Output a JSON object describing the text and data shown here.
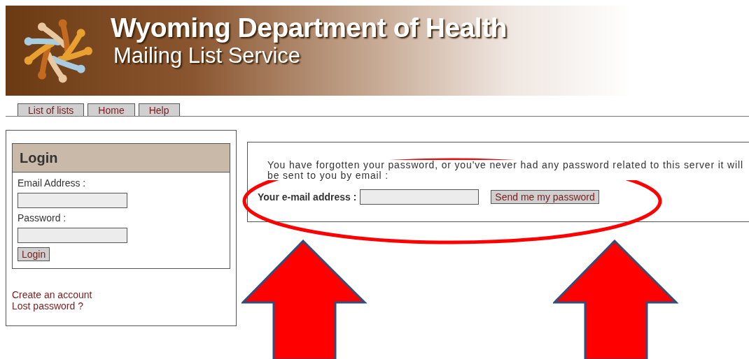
{
  "banner": {
    "title": "Wyoming Department of Health",
    "subtitle": "Mailing List Service"
  },
  "nav": [
    {
      "label": "List of lists"
    },
    {
      "label": "Home"
    },
    {
      "label": "Help"
    }
  ],
  "login": {
    "title": "Login",
    "email_label": "Email Address :",
    "password_label": "Password :",
    "button": "Login",
    "links": [
      "Create an account",
      "Lost password ?"
    ]
  },
  "reminder": {
    "message": "You have forgotten your password, or you've never had any password related to this server it will be sent to you by email :",
    "field_label": "Your e-mail address :",
    "button": "Send me my password"
  },
  "annotations": {
    "ellipse": true,
    "arrows": [
      {
        "kind": "up"
      },
      {
        "kind": "up"
      }
    ]
  }
}
